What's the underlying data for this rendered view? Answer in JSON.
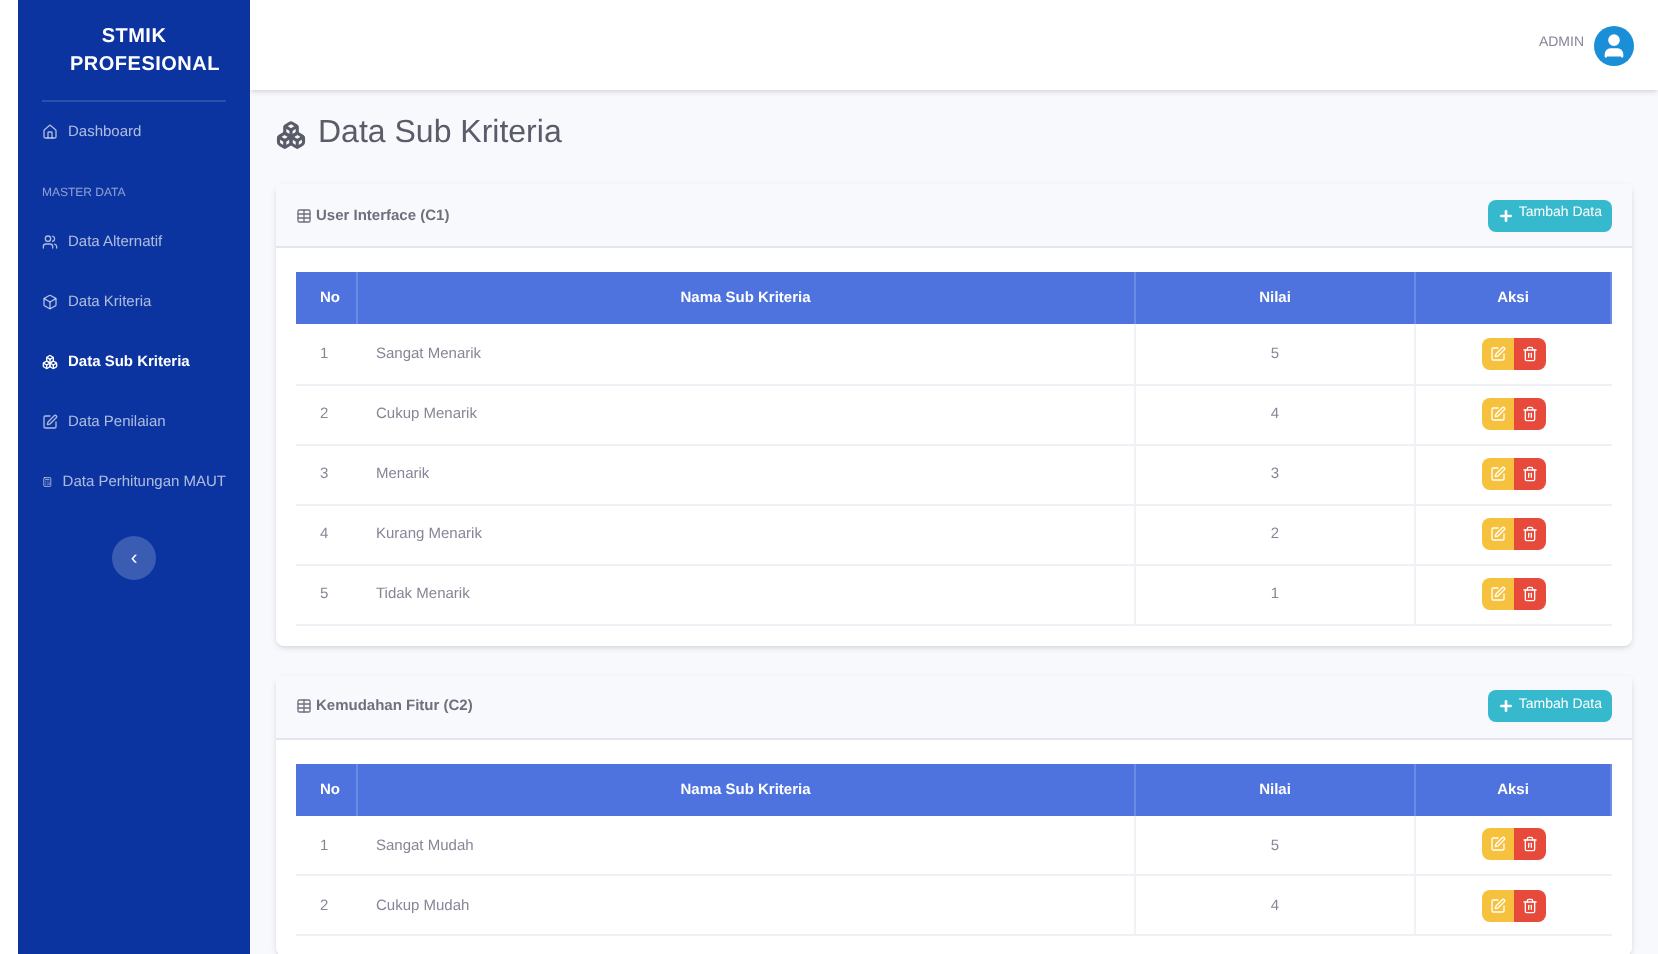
{
  "sidebar": {
    "brand": "STMIK PROFESIONAL",
    "items": [
      {
        "kind": "link",
        "label": "Dashboard",
        "selected": false
      },
      {
        "kind": "heading",
        "label": "MASTER DATA"
      },
      {
        "kind": "link",
        "label": "Data Alternatif",
        "selected": false
      },
      {
        "kind": "link",
        "label": "Data Kriteria",
        "selected": false
      },
      {
        "kind": "link",
        "label": "Data Sub Kriteria",
        "selected": true
      },
      {
        "kind": "link",
        "label": "Data Penilaian",
        "selected": false
      },
      {
        "kind": "link",
        "label": "Data Perhitungan MAUT",
        "selected": false
      }
    ],
    "collapse_button": "‹"
  },
  "topbar": {
    "user": "ADMIN"
  },
  "page_title": "Data Sub Kriteria",
  "cards": [
    {
      "title": "User Interface (C1)",
      "add_button": "Tambah Data",
      "columns": [
        "No",
        "Nama Sub Kriteria",
        "Nilai",
        "Aksi"
      ],
      "rows": [
        [
          "1",
          "Sangat Menarik",
          "5"
        ],
        [
          "2",
          "Cukup Menarik",
          "4"
        ],
        [
          "3",
          "Menarik",
          "3"
        ],
        [
          "4",
          "Kurang Menarik",
          "2"
        ],
        [
          "5",
          "Tidak Menarik",
          "1"
        ]
      ]
    },
    {
      "title": "Kemudahan Fitur (C2)",
      "add_button": "Tambah Data",
      "columns": [
        "No",
        "Nama Sub Kriteria",
        "Nilai",
        "Aksi"
      ],
      "rows": [
        [
          "1",
          "Sangat Mudah",
          "5"
        ],
        [
          "2",
          "Cukup Mudah",
          "4"
        ]
      ]
    }
  ]
}
